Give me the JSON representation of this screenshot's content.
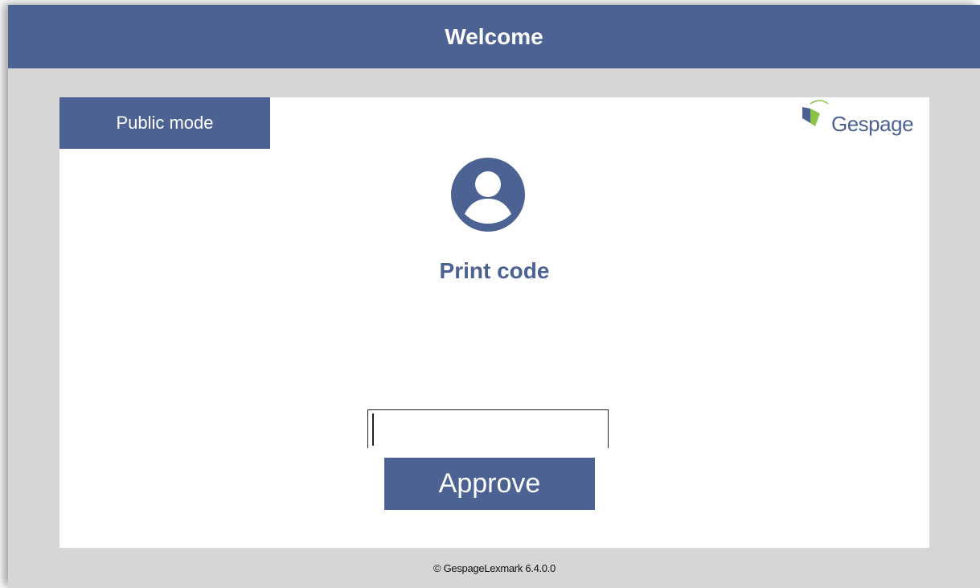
{
  "header": {
    "title": "Welcome"
  },
  "mode": {
    "label": "Public mode"
  },
  "logo": {
    "text": "Gespage",
    "icon": "gespage-logo-icon"
  },
  "main": {
    "avatar_icon": "user-avatar-icon",
    "heading": "Print code",
    "code_input": {
      "value": "",
      "placeholder": ""
    },
    "approve_label": "Approve"
  },
  "footer": {
    "copyright": "© GespageLexmark 6.4.0.0"
  },
  "colors": {
    "brand": "#4b6292",
    "background": "#d6d6d6",
    "panel": "#ffffff"
  }
}
